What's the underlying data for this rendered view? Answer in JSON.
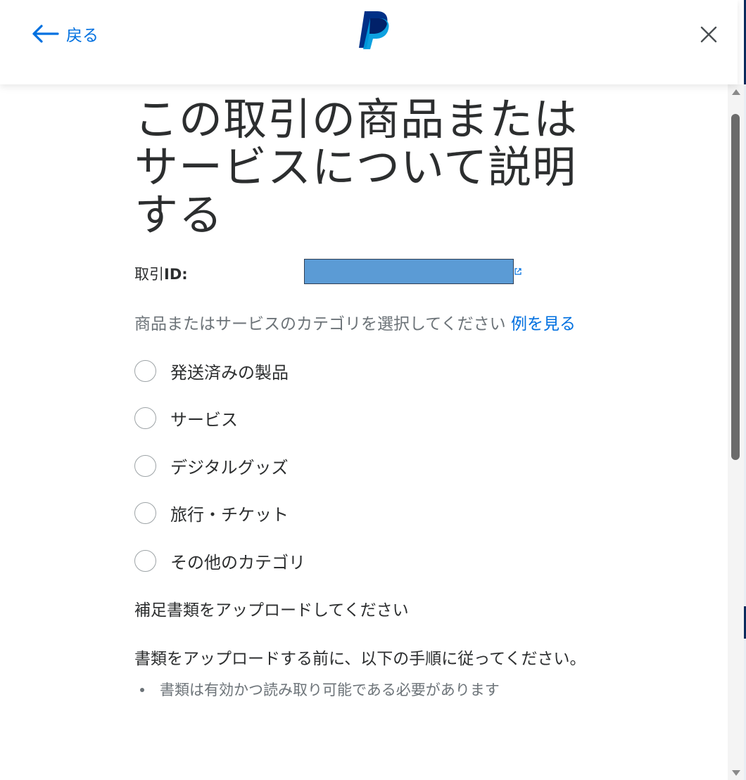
{
  "header": {
    "back_label": "戻る"
  },
  "title": "この取引の商品またはサービスについて説明する",
  "transaction": {
    "label_prefix": "取引",
    "label_bold": "ID:"
  },
  "category": {
    "prompt": "商品またはサービスのカテゴリを選択してください ",
    "example_link": "例を見る",
    "options": [
      "発送済みの製品",
      "サービス",
      "デジタルグッズ",
      "旅行・チケット",
      "その他のカテゴリ"
    ]
  },
  "upload": {
    "heading": "補足書類をアップロードしてください",
    "instructions": "書類をアップロードする前に、以下の手順に従ってください。",
    "bullets": [
      "書類は有効かつ読み取り可能である必要があります"
    ]
  },
  "colors": {
    "brand_blue": "#0070e0",
    "logo_dark": "#003087",
    "logo_light": "#009cde"
  },
  "icons": [
    "back-arrow-icon",
    "paypal-logo",
    "close-icon",
    "external-link-icon"
  ]
}
